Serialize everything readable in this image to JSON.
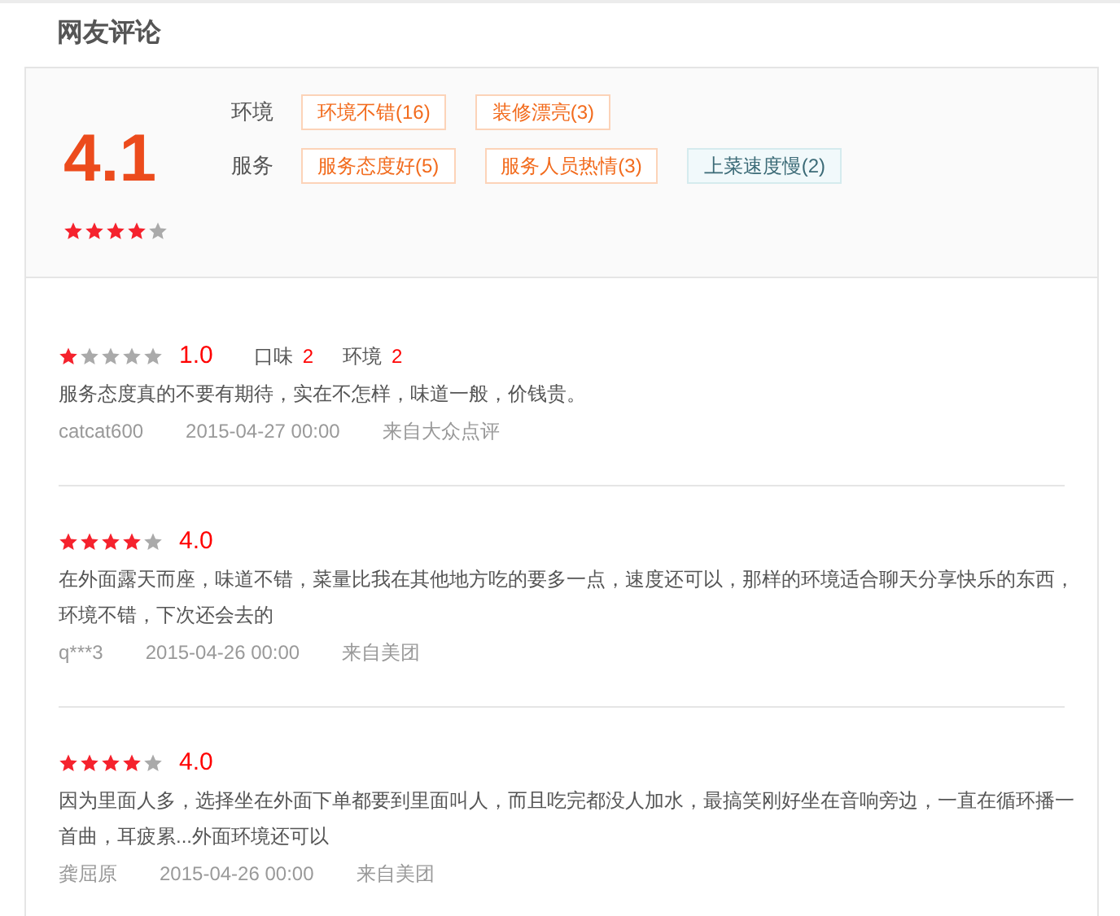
{
  "title": "网友评论",
  "summary": {
    "score": "4.1",
    "stars": 4,
    "groups": [
      {
        "label": "环境",
        "tags": [
          {
            "text": "环境不错(16)",
            "kind": "positive"
          },
          {
            "text": "装修漂亮(3)",
            "kind": "positive"
          }
        ]
      },
      {
        "label": "服务",
        "tags": [
          {
            "text": "服务态度好(5)",
            "kind": "positive"
          },
          {
            "text": "服务人员热情(3)",
            "kind": "positive"
          },
          {
            "text": "上菜速度慢(2)",
            "kind": "negative"
          }
        ]
      }
    ]
  },
  "reviews": [
    {
      "stars": 1,
      "score": "1.0",
      "aspects": [
        {
          "label": "口味",
          "value": "2"
        },
        {
          "label": "环境",
          "value": "2"
        }
      ],
      "text": "服务态度真的不要有期待，实在不怎样，味道一般，价钱贵。",
      "user": "catcat600",
      "date": "2015-04-27 00:00",
      "source": "来自大众点评"
    },
    {
      "stars": 4,
      "score": "4.0",
      "text": "在外面露天而座，味道不错，菜量比我在其他地方吃的要多一点，速度还可以，那样的环境适合聊天分享快乐的东西，环境不错，下次还会去的",
      "user": "q***3",
      "date": "2015-04-26 00:00",
      "source": "来自美团"
    },
    {
      "stars": 4,
      "score": "4.0",
      "text": "因为里面人多，选择坐在外面下单都要到里面叫人，而且吃完都没人加水，最搞笑刚好坐在音响旁边，一直在循环播一首曲，耳疲累...外面环境还可以",
      "user": "龚屈原",
      "date": "2015-04-26 00:00",
      "source": "来自美团"
    }
  ]
}
